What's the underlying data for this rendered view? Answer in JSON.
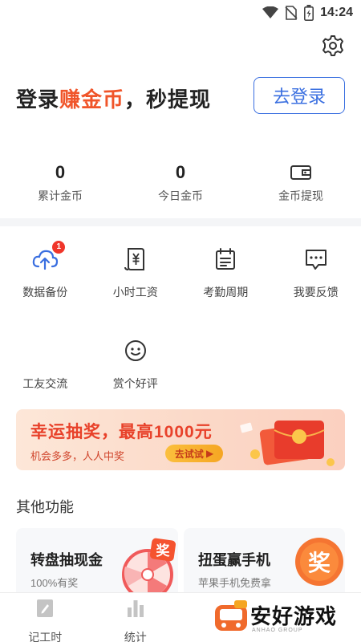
{
  "status_bar": {
    "time": "14:24",
    "icons": [
      "wifi-icon",
      "no-sim-icon",
      "battery-icon"
    ]
  },
  "header": {
    "settings_icon": "gear-icon"
  },
  "login": {
    "title_prefix": "登录",
    "title_highlight": "赚金币",
    "title_suffix": "，秒提现",
    "button": "去登录",
    "accent": "#f0552a",
    "button_color": "#3a6fe0"
  },
  "coins": {
    "total_value": "0",
    "total_label": "累计金币",
    "today_value": "0",
    "today_label": "今日金币",
    "withdraw_label": "金币提现"
  },
  "grid": {
    "items": [
      {
        "label": "数据备份",
        "icon": "cloud-upload-icon",
        "badge": "1"
      },
      {
        "label": "小时工资",
        "icon": "yen-document-icon"
      },
      {
        "label": "考勤周期",
        "icon": "calendar-icon"
      },
      {
        "label": "我要反馈",
        "icon": "chat-bubble-icon"
      },
      {
        "label": "工友交流",
        "icon": ""
      },
      {
        "label": "赏个好评",
        "icon": "smile-icon"
      }
    ]
  },
  "banner": {
    "title": "幸运抽奖，最高1000元",
    "subtitle": "机会多多，人人中奖",
    "button": "去试试"
  },
  "other": {
    "title": "其他功能",
    "cards": [
      {
        "title": "转盘抽现金",
        "subtitle": "100%有奖",
        "tag": "奖"
      },
      {
        "title": "扭蛋赢手机",
        "subtitle": "苹果手机免费拿",
        "tag": "奖"
      }
    ]
  },
  "tabbar": {
    "items": [
      {
        "label": "记工时",
        "icon": "edit-icon"
      },
      {
        "label": "统计",
        "icon": "bar-chart-icon"
      }
    ]
  },
  "watermark": {
    "text": "安好游戏",
    "sub": "ANHAO GROUP"
  }
}
